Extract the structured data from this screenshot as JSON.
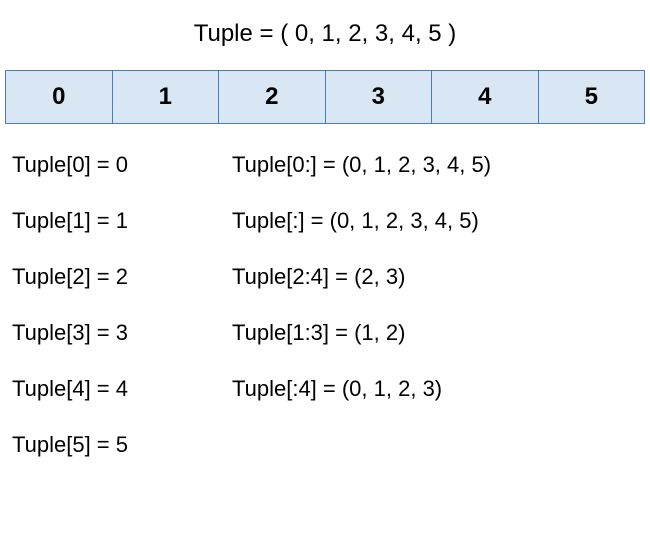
{
  "title": "Tuple = ( 0, 1, 2, 3, 4, 5 )",
  "cells": [
    "0",
    "1",
    "2",
    "3",
    "4",
    "5"
  ],
  "left_examples": [
    "Tuple[0] = 0",
    "Tuple[1] = 1",
    "Tuple[2] = 2",
    "Tuple[3] = 3",
    "Tuple[4] = 4",
    "Tuple[5] = 5"
  ],
  "right_examples": [
    "Tuple[0:] = (0, 1, 2, 3, 4, 5)",
    "Tuple[:] = (0, 1, 2, 3, 4, 5)",
    "Tuple[2:4] = (2, 3)",
    "Tuple[1:3]  = (1, 2)",
    "Tuple[:4] = (0, 1, 2, 3)"
  ]
}
